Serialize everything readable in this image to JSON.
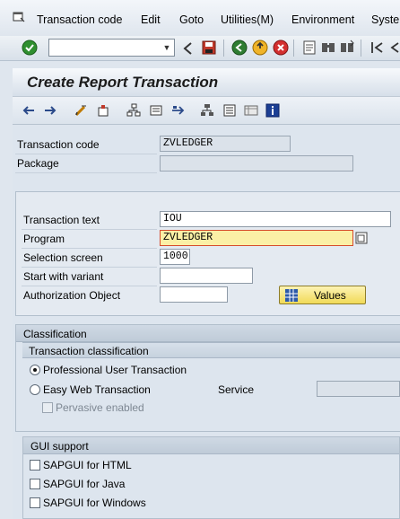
{
  "menu": {
    "items": [
      "Transaction code",
      "Edit",
      "Goto",
      "Utilities(M)",
      "Environment",
      "Syste"
    ]
  },
  "toolbar": {
    "command_field_value": "",
    "icons": [
      "enter-icon",
      "back-icon",
      "save-icon",
      "back-green-icon",
      "exit-icon",
      "cancel-icon",
      "print-icon",
      "find-icon",
      "find-next-icon",
      "first-page-icon"
    ]
  },
  "title": "Create Report Transaction",
  "app_toolbar": {
    "icons": [
      "back-arrow-icon",
      "forward-arrow-icon",
      "display-change-icon",
      "other-object-icon",
      "hierarchy-icon",
      "display-object-list-icon",
      "navigate-icon",
      "tree-icon",
      "list-icon",
      "table-icon",
      "info-icon"
    ]
  },
  "header": {
    "transaction_code_label": "Transaction code",
    "transaction_code_value": "ZVLEDGER",
    "package_label": "Package",
    "package_value": ""
  },
  "details": {
    "transaction_text_label": "Transaction text",
    "transaction_text_value": "IOU",
    "program_label": "Program",
    "program_value": "ZVLEDGER",
    "selection_screen_label": "Selection screen",
    "selection_screen_value": "1000",
    "start_variant_label": "Start with variant",
    "start_variant_value": "",
    "auth_object_label": "Authorization Object",
    "auth_object_value": "",
    "values_button": "Values"
  },
  "classification": {
    "title": "Classification",
    "sub_title": "Transaction classification",
    "options": [
      {
        "label": "Professional User Transaction",
        "selected": true
      },
      {
        "label": "Easy Web Transaction",
        "selected": false
      }
    ],
    "service_label": "Service",
    "service_value": "",
    "pervasive_label": "Pervasive enabled"
  },
  "gui_support": {
    "title": "GUI support",
    "options": [
      "SAPGUI for HTML",
      "SAPGUI for Java",
      "SAPGUI for Windows"
    ]
  },
  "colors": {
    "required_field_bg": "#fbf0a6",
    "required_field_border": "#d64d2d",
    "background": "#dde5ee"
  }
}
